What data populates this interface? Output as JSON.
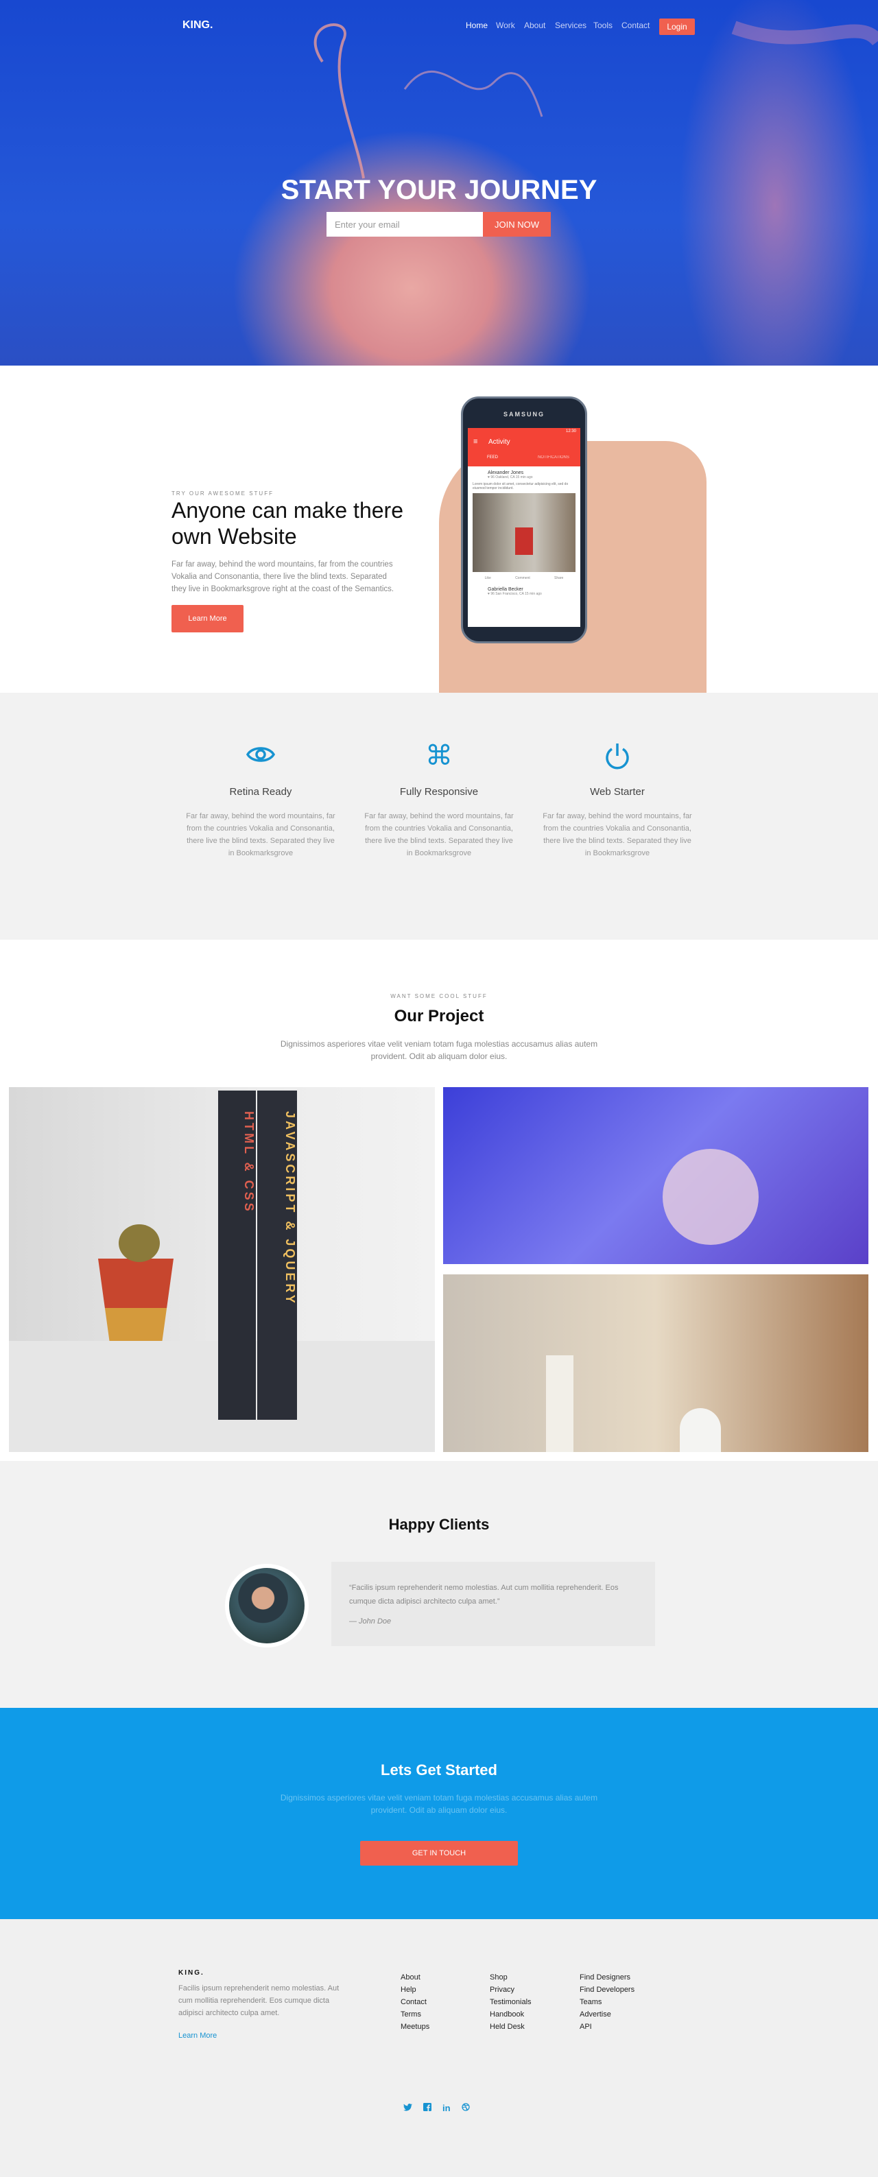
{
  "header": {
    "logo": "KING.",
    "nav": [
      {
        "label": "Home",
        "active": true
      },
      {
        "label": "Work"
      },
      {
        "label": "About"
      },
      {
        "label": "Services"
      },
      {
        "label": "Tools"
      },
      {
        "label": "Contact"
      }
    ],
    "login_label": "Login"
  },
  "hero": {
    "title": "START YOUR JOURNEY",
    "email_placeholder": "Enter your email",
    "join_label": "JOIN NOW"
  },
  "intro": {
    "kicker": "TRY OUR AWESOME STUFF",
    "title": "Anyone can make there own Website",
    "text": "Far far away, behind the word mountains, far from the countries Vokalia and Consonantia, there live the blind texts. Separated they live in Bookmarksgrove right at the coast of the Semantics.",
    "button": "Learn More",
    "phone": {
      "brand": "SAMSUNG",
      "time": "12:30",
      "app_title": "Activity",
      "tabs": [
        "FEED",
        "NOTIFICATIONS"
      ],
      "post1_name": "Alexander Jones",
      "post1_meta": "♥ 96   Oakland, CA   15 min ago",
      "post1_text": "Lorem ipsum dolor sit amet, consectetur adipisicing elit, sed do eiusmod tempor incididunt.",
      "actions": [
        "Like",
        "Comment",
        "Share"
      ],
      "post2_name": "Gabriella Becker",
      "post2_meta": "♥ 96   San Francisco, CA   15 min ago"
    }
  },
  "features": [
    {
      "icon": "eye-icon",
      "title": "Retina Ready",
      "text": "Far far away, behind the word mountains, far from the countries Vokalia and Consonantia, there live the blind texts. Separated they live in Bookmarksgrove"
    },
    {
      "icon": "command-icon",
      "title": "Fully Responsive",
      "text": "Far far away, behind the word mountains, far from the countries Vokalia and Consonantia, there live the blind texts. Separated they live in Bookmarksgrove"
    },
    {
      "icon": "power-icon",
      "title": "Web Starter",
      "text": "Far far away, behind the word mountains, far from the countries Vokalia and Consonantia, there live the blind texts. Separated they live in Bookmarksgrove"
    }
  ],
  "project": {
    "kicker": "WANT SOME COOL STUFF",
    "title": "Our Project",
    "text": "Dignissimos asperiores vitae velit veniam totam fuga molestias accusamus alias autem provident. Odit ab aliquam dolor eius.",
    "book1": "HTML & CSS",
    "book2": "JAVASCRIPT & JQUERY"
  },
  "clients": {
    "title": "Happy Clients",
    "quote": "“Facilis ipsum reprehenderit nemo molestias. Aut cum mollitia reprehenderit. Eos cumque dicta adipisci architecto culpa amet.”",
    "author": "— John Doe"
  },
  "cta": {
    "title": "Lets Get Started",
    "text": "Dignissimos asperiores vitae velit veniam totam fuga molestias accusamus alias autem provident. Odit ab aliquam dolor eius.",
    "button": "GET IN TOUCH"
  },
  "footer": {
    "logo": "KING.",
    "text": "Facilis ipsum reprehenderit nemo molestias. Aut cum mollitia reprehenderit. Eos cumque dicta adipisci architecto culpa amet.",
    "learn_more": "Learn More",
    "columns": [
      [
        "About",
        "Help",
        "Contact",
        "Terms",
        "Meetups"
      ],
      [
        "Shop",
        "Privacy",
        "Testimonials",
        "Handbook",
        "Held Desk"
      ],
      [
        "Find Designers",
        "Find Developers",
        "Teams",
        "Advertise",
        "API"
      ]
    ],
    "social": [
      "twitter-icon",
      "facebook-icon",
      "linkedin-icon",
      "dribbble-icon"
    ]
  },
  "colors": {
    "accent": "#f0604f",
    "blue": "#0f9be8",
    "icon_blue": "#1793d1"
  }
}
